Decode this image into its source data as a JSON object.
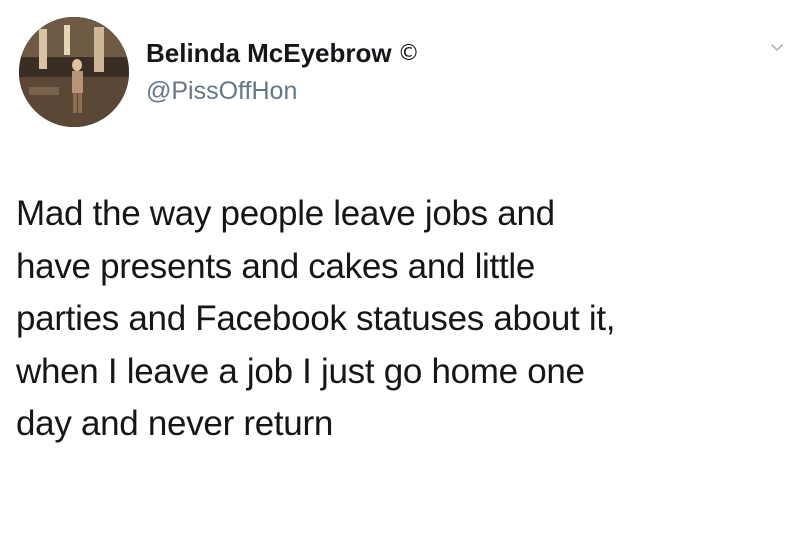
{
  "author": {
    "display_name": "Belinda McEyebrow",
    "name_emoji": "©",
    "handle": "@PissOffHon",
    "avatar_icon": "profile-photo"
  },
  "header": {
    "menu_icon": "chevron-down-icon"
  },
  "tweet": {
    "lines": [
      "Mad the way people leave jobs and",
      "have presents and cakes and little",
      "parties and Facebook statuses about it,",
      "when I leave a job I just go home one",
      "day and never return"
    ]
  }
}
